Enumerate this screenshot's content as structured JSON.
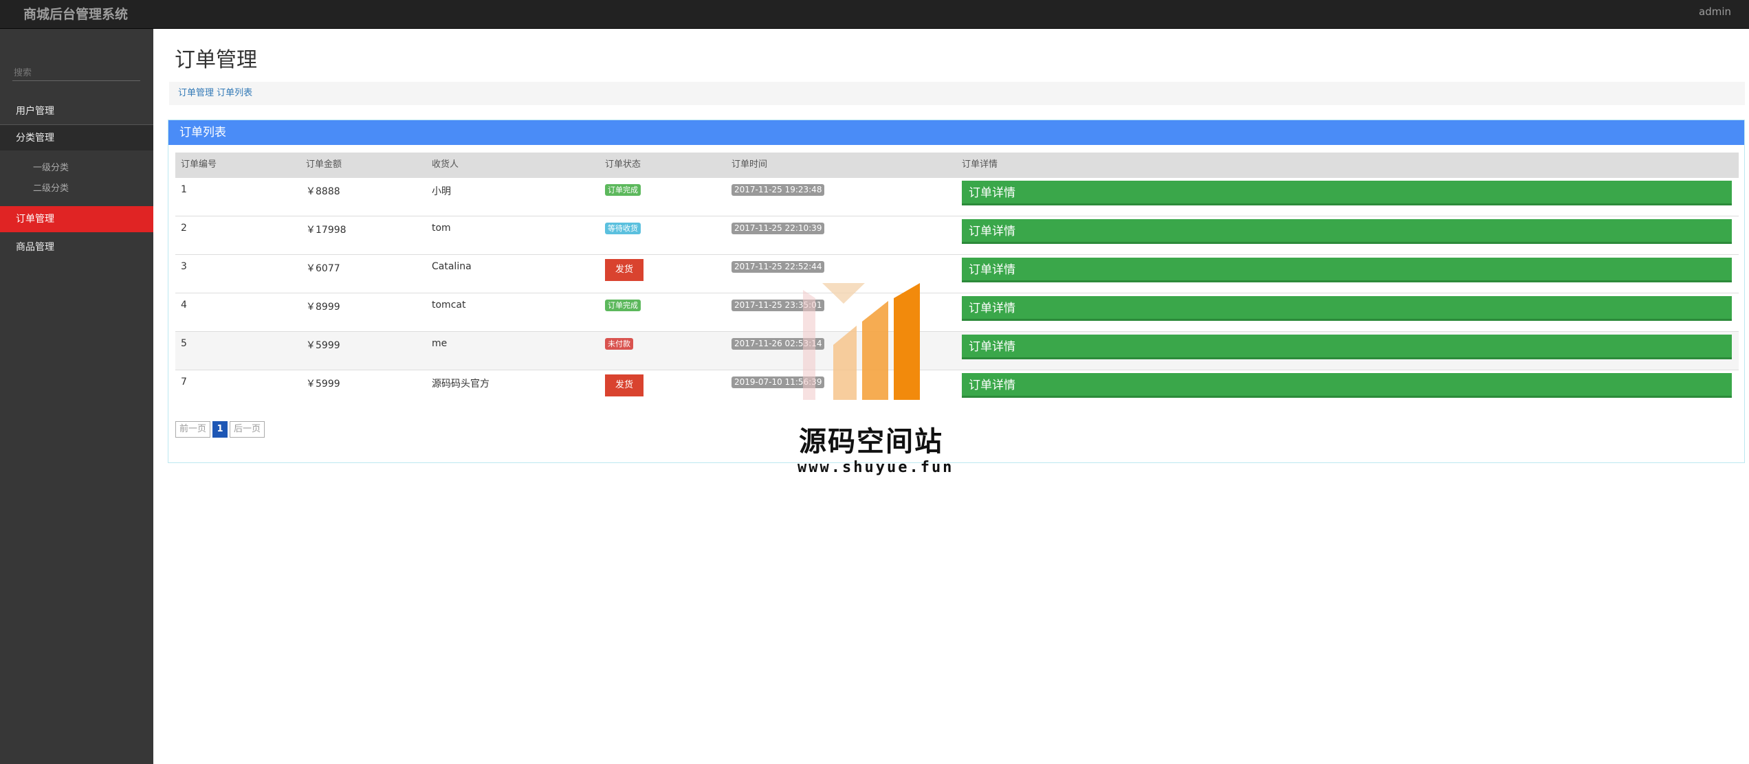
{
  "header": {
    "brand_icon": "",
    "brand": "商城后台管理系统",
    "user_icon": "",
    "user": "admin",
    "caret_icon": ""
  },
  "sidebar": {
    "toggle_icon": "",
    "search_placeholder": "搜索",
    "items": [
      {
        "icon": "",
        "label": "用户管理"
      },
      {
        "icon": "",
        "label": "分类管理",
        "caret": ""
      },
      {
        "icon": "",
        "label": "订单管理"
      },
      {
        "icon": "",
        "label": "商品管理"
      }
    ],
    "subitems": [
      {
        "icon": "",
        "label": "一级分类"
      },
      {
        "icon": "",
        "label": "二级分类"
      }
    ]
  },
  "page": {
    "title_icon": "",
    "title": "订单管理",
    "breadcrumb": {
      "first": "订单管理",
      "sep_icon": "",
      "second": "订单列表"
    }
  },
  "panel": {
    "icon": "",
    "title": "订单列表",
    "columns": [
      "订单编号",
      "订单金额",
      "收货人",
      "订单状态",
      "订单时间",
      "订单详情"
    ],
    "detail_label": "订单详情",
    "detail_icon": "",
    "rows": [
      {
        "id": "1",
        "amount": "￥8888",
        "receiver": "小明",
        "status": "订单完成",
        "time": "2017-11-25 19:23:48"
      },
      {
        "id": "2",
        "amount": "￥17998",
        "receiver": "tom",
        "status": "等待收货",
        "time": "2017-11-25 22:10:39"
      },
      {
        "id": "3",
        "amount": "￥6077",
        "receiver": "Catalina",
        "status": "发货",
        "time": "2017-11-25 22:52:44"
      },
      {
        "id": "4",
        "amount": "￥8999",
        "receiver": "tomcat",
        "status": "订单完成",
        "time": "2017-11-25 23:35:01"
      },
      {
        "id": "5",
        "amount": "￥5999",
        "receiver": "me",
        "status": "未付款",
        "time": "2017-11-26 02:53:14"
      },
      {
        "id": "7",
        "amount": "￥5999",
        "receiver": "源码码头官方",
        "status": "发货",
        "time": "2019-07-10 11:56:39"
      }
    ]
  },
  "pager": {
    "prev": "前一页",
    "current": "1",
    "next": "后一页"
  },
  "watermark": {
    "title": "源码空间站",
    "url": "www.shuyue.fun"
  },
  "colors": {
    "accent": "#4a8cf7",
    "active_nav": "#e02424",
    "detail_button": "#3aa74a"
  }
}
